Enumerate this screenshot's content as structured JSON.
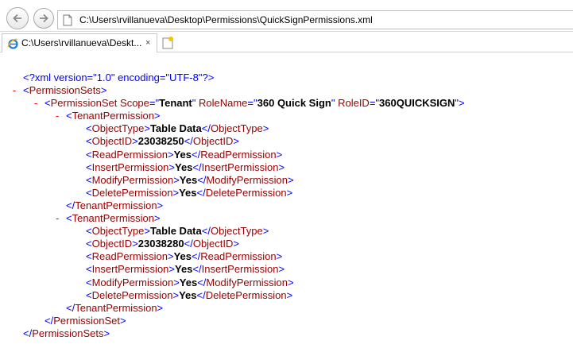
{
  "address_bar": {
    "url": "C:\\Users\\rvillanueva\\Desktop\\Permissions\\QuickSignPermissions.xml"
  },
  "tab": {
    "title": "C:\\Users\\rvillanueva\\Deskt...",
    "close": "×"
  },
  "colors": {
    "bracket": "#0000ff",
    "tag": "#990000",
    "value": "#000000",
    "collapse": "#ff0000"
  },
  "icons": [
    "back-arrow-icon",
    "forward-arrow-icon",
    "document-icon",
    "ie-logo-icon",
    "new-tab-icon",
    "collapse-minus-icon"
  ],
  "xml": {
    "declaration": "<?xml version=\"1.0\" encoding=\"UTF-8\"?>",
    "collapse": "-",
    "open_bracket": "<",
    "close_bracket": ">",
    "end_open": "</",
    "root_tag": "PermissionSets",
    "set_tag": "PermissionSet",
    "set_attrs": [
      {
        "name": "Scope",
        "value": "Tenant"
      },
      {
        "name": "RoleName",
        "value": "360 Quick Sign"
      },
      {
        "name": "RoleID",
        "value": "360QUICKSIGN"
      }
    ],
    "eq": "=",
    "quote": "\"",
    "perm_tag": "TenantPermission",
    "permissions": [
      {
        "fields": [
          {
            "tag": "ObjectType",
            "value": "Table Data"
          },
          {
            "tag": "ObjectID",
            "value": "23038250"
          },
          {
            "tag": "ReadPermission",
            "value": "Yes"
          },
          {
            "tag": "InsertPermission",
            "value": "Yes"
          },
          {
            "tag": "ModifyPermission",
            "value": "Yes"
          },
          {
            "tag": "DeletePermission",
            "value": "Yes"
          }
        ]
      },
      {
        "fields": [
          {
            "tag": "ObjectType",
            "value": "Table Data"
          },
          {
            "tag": "ObjectID",
            "value": "23038280"
          },
          {
            "tag": "ReadPermission",
            "value": "Yes"
          },
          {
            "tag": "InsertPermission",
            "value": "Yes"
          },
          {
            "tag": "ModifyPermission",
            "value": "Yes"
          },
          {
            "tag": "DeletePermission",
            "value": "Yes"
          }
        ]
      }
    ]
  }
}
